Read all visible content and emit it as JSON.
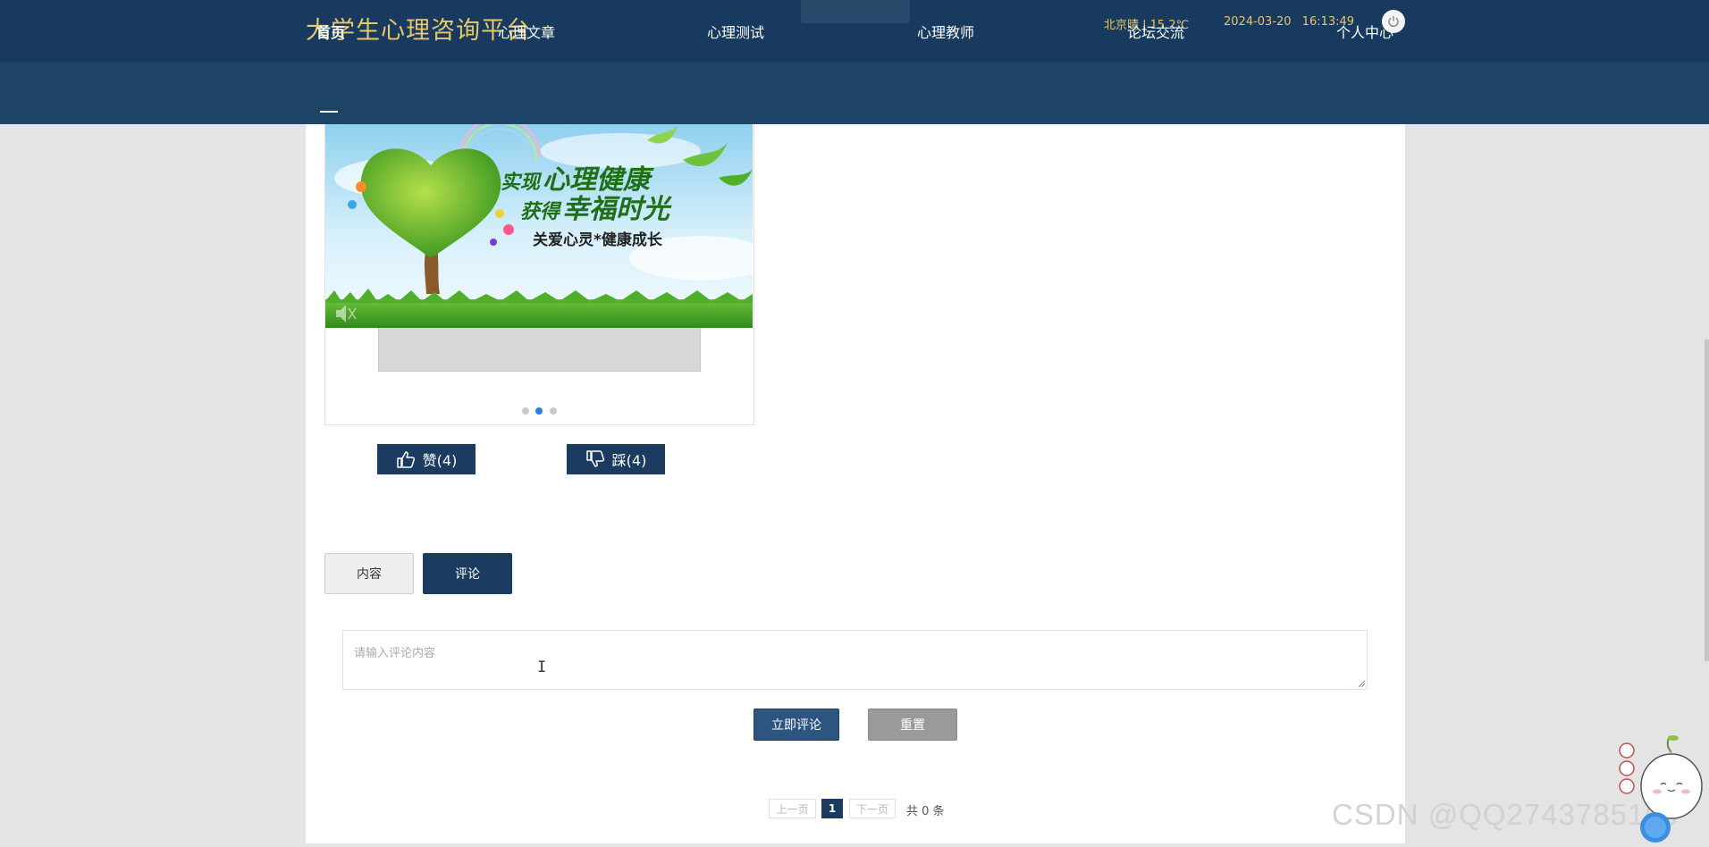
{
  "header": {
    "site_title": "大学生心理咨询平台",
    "weather": "北京晴 | 15.2℃",
    "datetime": "2024-03-20 16:13:49"
  },
  "nav": {
    "items": [
      {
        "label": "首页",
        "active": true
      },
      {
        "label": "心理文章",
        "active": false
      },
      {
        "label": "心理测试",
        "active": false
      },
      {
        "label": "心理教师",
        "active": false
      },
      {
        "label": "论坛交流",
        "active": false
      },
      {
        "label": "个人中心",
        "active": false
      }
    ]
  },
  "banner": {
    "line1_prefix": "实现",
    "line1_emph": "心理健康",
    "line2_prefix": "获得",
    "line2_emph": "幸福时光",
    "line3": "关爱心灵*健康成长"
  },
  "carousel": {
    "dots": 3,
    "active_dot": 1
  },
  "votes": {
    "like_label": "赞(4)",
    "dislike_label": "踩(4)"
  },
  "tabs": {
    "content_label": "内容",
    "comment_label": "评论",
    "active": "comment"
  },
  "comment": {
    "placeholder": "请输入评论内容",
    "submit_label": "立即评论",
    "reset_label": "重置"
  },
  "pager": {
    "prev_label": "上一页",
    "current_page": "1",
    "next_label": "下一页",
    "total_label": "共 0 条"
  },
  "watermark": "CSDN @QQ2743785109",
  "colors": {
    "header_bg": "#183a5e",
    "nav_bg": "#1e4568",
    "title_gold": "#e8c76a",
    "button_navy": "#1b3c60",
    "page_bg": "#e4e4e4"
  }
}
